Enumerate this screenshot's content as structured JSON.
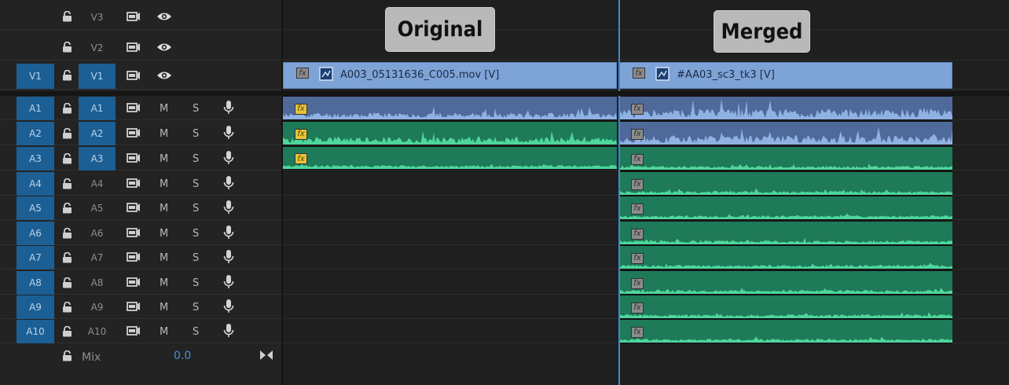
{
  "video_tracks": [
    {
      "name": "V3",
      "target": ""
    },
    {
      "name": "V2",
      "target": ""
    },
    {
      "name": "V1",
      "target": "V1"
    }
  ],
  "audio_tracks": [
    {
      "target": "A1",
      "name": "A1",
      "mute": "M",
      "solo": "S"
    },
    {
      "target": "A2",
      "name": "A2",
      "mute": "M",
      "solo": "S"
    },
    {
      "target": "A3",
      "name": "A3",
      "mute": "M",
      "solo": "S"
    },
    {
      "target": "A4",
      "name": "A4",
      "mute": "M",
      "solo": "S"
    },
    {
      "target": "A5",
      "name": "A5",
      "mute": "M",
      "solo": "S"
    },
    {
      "target": "A6",
      "name": "A6",
      "mute": "M",
      "solo": "S"
    },
    {
      "target": "A7",
      "name": "A7",
      "mute": "M",
      "solo": "S"
    },
    {
      "target": "A8",
      "name": "A8",
      "mute": "M",
      "solo": "S"
    },
    {
      "target": "A9",
      "name": "A9",
      "mute": "M",
      "solo": "S"
    },
    {
      "target": "A10",
      "name": "A10",
      "mute": "M",
      "solo": "S"
    }
  ],
  "mix": {
    "label": "Mix",
    "value": "0.0"
  },
  "clips": {
    "original_video": "A003_05131636_C005.mov [V]",
    "merged_video": "#AA03_sc3_tk3 [V]",
    "fx_label": "fx"
  },
  "captions": {
    "original": "Original",
    "merged": "Merged"
  },
  "colors": {
    "target_blue": "#1b5f95",
    "video_clip": "#7ea3d6",
    "audio_clip_blue": "#4f6a9a",
    "audio_clip_green": "#1e7a58",
    "waveform_green": "#4fd69c",
    "playhead": "#3b8ad6"
  }
}
